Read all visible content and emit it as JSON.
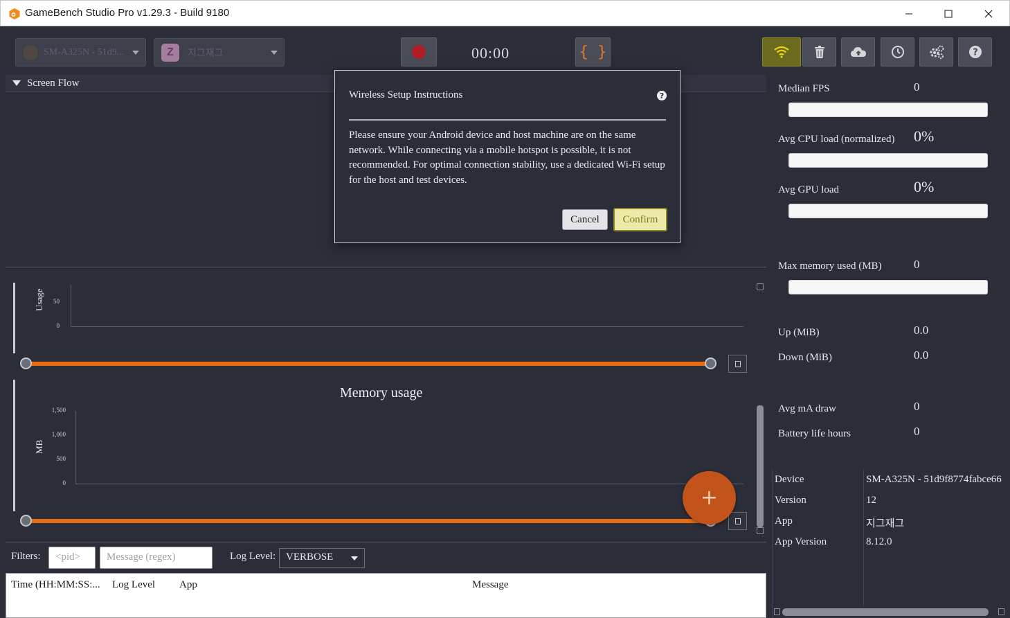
{
  "window": {
    "title": "GameBench Studio Pro v1.29.3 - Build 9180",
    "minimize": "—",
    "maximize": "☐",
    "close": "✕"
  },
  "toolbar": {
    "device_select": "SM-A325N - 51d9...",
    "app_select": "지그재그",
    "app_icon_letter": "Z",
    "timer": "00:00",
    "json_label": "{ }",
    "icons": [
      "wifi-icon",
      "trash-icon",
      "cloud-upload-icon",
      "history-icon",
      "settings-icon",
      "help-icon"
    ]
  },
  "screen_flow": {
    "header": "Screen Flow"
  },
  "charts": {
    "usage": {
      "ylabel": "Usage",
      "ticks": [
        "50",
        "0"
      ]
    },
    "memory": {
      "title": "Memory usage",
      "ylabel": "MB",
      "ticks": [
        "1,500",
        "1,000",
        "500",
        "0"
      ]
    },
    "fab_label": "+"
  },
  "filters": {
    "label": "Filters:",
    "pid_placeholder": "<pid>",
    "message_placeholder": "Message (regex)",
    "log_level_label": "Log Level:",
    "log_level_value": "VERBOSE"
  },
  "log_table": {
    "columns": [
      "Time (HH:MM:SS:...",
      "Log Level",
      "App",
      "Message"
    ]
  },
  "metrics": [
    {
      "label": "Median FPS",
      "value": "0"
    },
    {
      "label": "Avg CPU load (normalized)",
      "value": "0%"
    },
    {
      "label": "Avg GPU load",
      "value": "0%"
    },
    {
      "label": "Max memory used (MB)",
      "value": "0"
    },
    {
      "label": "Up (MiB)",
      "value": "0.0"
    },
    {
      "label": "Down (MiB)",
      "value": "0.0"
    },
    {
      "label": "Avg mA draw",
      "value": "0"
    },
    {
      "label": "Battery life hours",
      "value": "0"
    }
  ],
  "device_info": [
    {
      "key": "Device",
      "value": "SM-A325N - 51d9f8774fabce66"
    },
    {
      "key": "Version",
      "value": "12"
    },
    {
      "key": "App",
      "value": "지그재그"
    },
    {
      "key": "App Version",
      "value": "8.12.0"
    }
  ],
  "modal": {
    "title": "Wireless Setup Instructions",
    "help": "?",
    "body": "Please ensure your Android device and host machine are on the same network. While connecting via a mobile hotspot is possible, it is not recommended. For optimal connection stability, use a dedicated Wi-Fi setup for the host and test devices.",
    "cancel": "Cancel",
    "confirm": "Confirm"
  },
  "colors": {
    "background": "#2b2d38",
    "accent_orange": "#e86e14",
    "record_red": "#b01e25",
    "wifi_active": "#6c6a1f",
    "confirm_bg": "#eceaa8"
  }
}
